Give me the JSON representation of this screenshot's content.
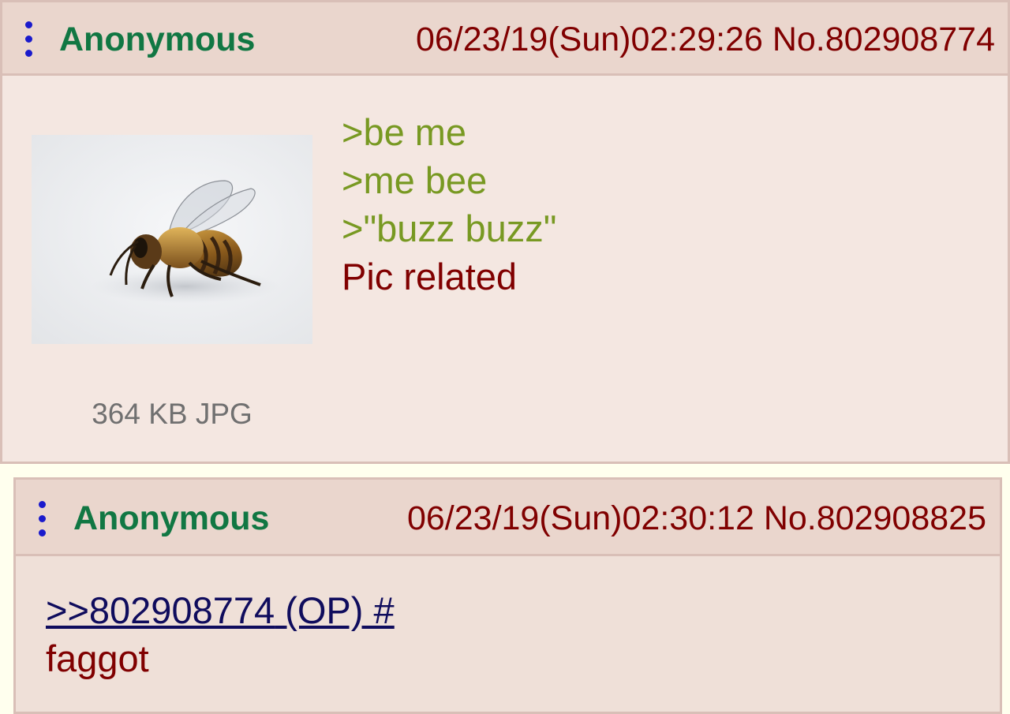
{
  "posts": [
    {
      "name": "Anonymous",
      "datetime": "06/23/19(Sun)02:29:26",
      "post_no": "No.802908774",
      "file_info": "364 KB JPG",
      "thumbnail": "bee-photo",
      "lines": [
        {
          "text": ">be me",
          "type": "greentext"
        },
        {
          "text": ">me bee",
          "type": "greentext"
        },
        {
          "text": ">\"buzz buzz\"",
          "type": "greentext"
        },
        {
          "text": "Pic related",
          "type": "plain"
        }
      ]
    },
    {
      "name": "Anonymous",
      "datetime": "06/23/19(Sun)02:30:12",
      "post_no": "No.802908825",
      "quote_link": ">>802908774",
      "quote_op": "(OP)",
      "quote_hash": "#",
      "lines": [
        {
          "text": "faggot",
          "type": "plain"
        }
      ]
    }
  ],
  "colors": {
    "page_bg": "#ffffee",
    "post_bg": "#f4e7e1",
    "header_bg": "#ead6cd",
    "border": "#d9bfb7",
    "name": "#117743",
    "datetime": "#800000",
    "greentext": "#789922",
    "body_text": "#800000",
    "quote_link": "#0f0c5d",
    "file_info": "#707070",
    "menu_icon": "#1a1acc"
  },
  "icons": [
    "post-menu-icon"
  ]
}
